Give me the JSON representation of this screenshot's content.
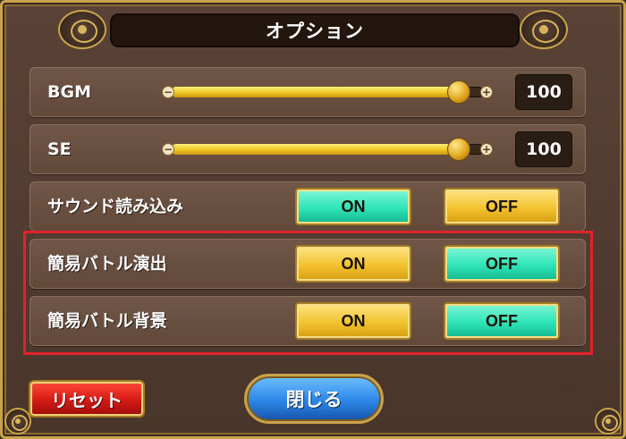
{
  "dialog": {
    "title": "オプション"
  },
  "settings": {
    "bgm": {
      "label": "BGM",
      "value": 100,
      "value_text": "100",
      "fraction": 0.92
    },
    "se": {
      "label": "SE",
      "value": 100,
      "value_text": "100",
      "fraction": 0.92
    },
    "sound_load": {
      "label": "サウンド読み込み",
      "on_label": "ON",
      "off_label": "OFF",
      "selected": "ON"
    },
    "simple_battle_effect": {
      "label": "簡易バトル演出",
      "on_label": "ON",
      "off_label": "OFF",
      "selected": "OFF"
    },
    "simple_battle_background": {
      "label": "簡易バトル背景",
      "on_label": "ON",
      "off_label": "OFF",
      "selected": "OFF"
    }
  },
  "slider_icons": {
    "minus": "−",
    "plus": "+"
  },
  "footer": {
    "reset_label": "リセット",
    "close_label": "閉じる"
  },
  "colors": {
    "toggle_active": "#2ee4b8",
    "toggle_inactive": "#f2c22f",
    "highlight_border": "#e2222b",
    "reset_button": "#d51a14",
    "close_button": "#2c86e8"
  }
}
